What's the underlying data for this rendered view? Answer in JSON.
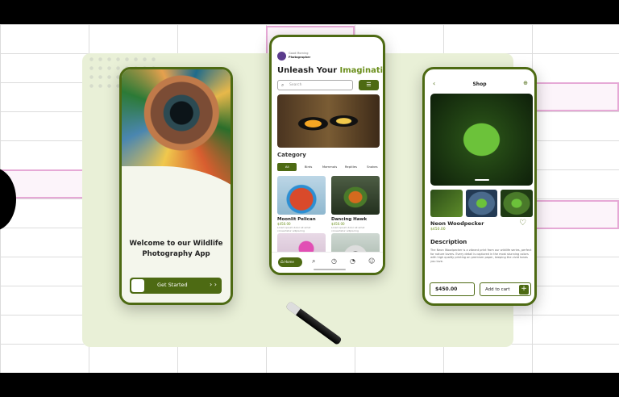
{
  "colors": {
    "accent": "#4d6a13",
    "accent_light": "#6b8f1c",
    "board": "#e9f0d7"
  },
  "onboarding": {
    "welcome_line1": "Welcome to our Wildlife",
    "welcome_line2": "Photography App",
    "cta": "Get Started",
    "cta_arrows": "› ›"
  },
  "home": {
    "user_line1": "Good Morning",
    "user_line2": "Photographer",
    "title_prefix": "Unleash Your ",
    "title_highlight": "Imagination",
    "search_placeholder": "Search",
    "category_heading": "Category",
    "categories": [
      "All",
      "Birds",
      "Mammals",
      "Reptiles",
      "Snakes"
    ],
    "products": [
      {
        "name": "Moonlit Pelican",
        "price": "$450.00",
        "desc": "Lorem ipsum dolor sit amet consectetur adipiscing"
      },
      {
        "name": "Dancing Hawk",
        "price": "$450.00",
        "desc": "Lorem ipsum dolor sit amet consectetur adipiscing"
      }
    ],
    "nav": {
      "home": "Home",
      "icons": [
        "search-icon",
        "clock-icon",
        "history-icon",
        "user-icon"
      ]
    }
  },
  "detail": {
    "header": "Shop",
    "product_name": "Neon Woodpecker",
    "product_price": "$450.00",
    "description_heading": "Description",
    "description": "The Neon Woodpecker is a vibrant print from our wildlife series, perfect for nature lovers. Every detail is captured in the most stunning colors with high quality printing on premium paper, keeping the vivid tones you love.",
    "total_price": "$450.00",
    "add_to_cart": "Add to cart"
  }
}
